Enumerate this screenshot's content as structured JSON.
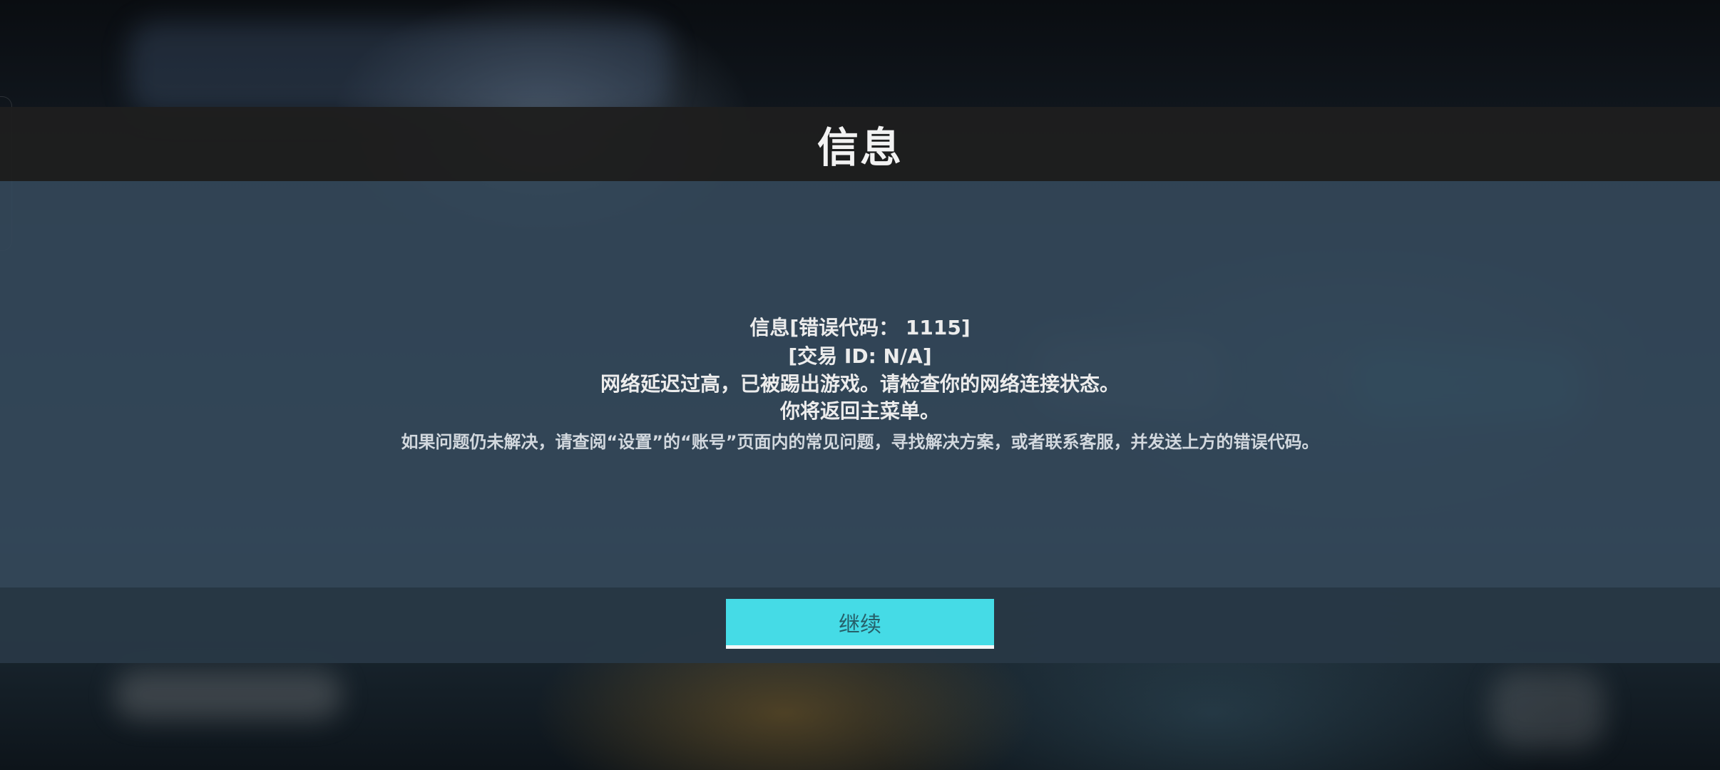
{
  "dialog": {
    "title": "信息",
    "message": {
      "error_code_line": "信息[错误代码： 1115]",
      "transaction_line": "[交易 ID: N/A]",
      "reason_line": "网络延迟过高，已被踢出游戏。请检查你的网络连接状态。",
      "return_line": "你将返回主菜单。",
      "help_line": "如果问题仍未解决，请查阅“设置”的“账号”页面内的常见问题，寻找解决方案，或者联系客服，并发送上方的错误代码。"
    },
    "continue_label": "继续"
  },
  "colors": {
    "button_accent": "#45dbe6",
    "header_bg": "#1e1e1e",
    "body_bg": "#34485a"
  }
}
